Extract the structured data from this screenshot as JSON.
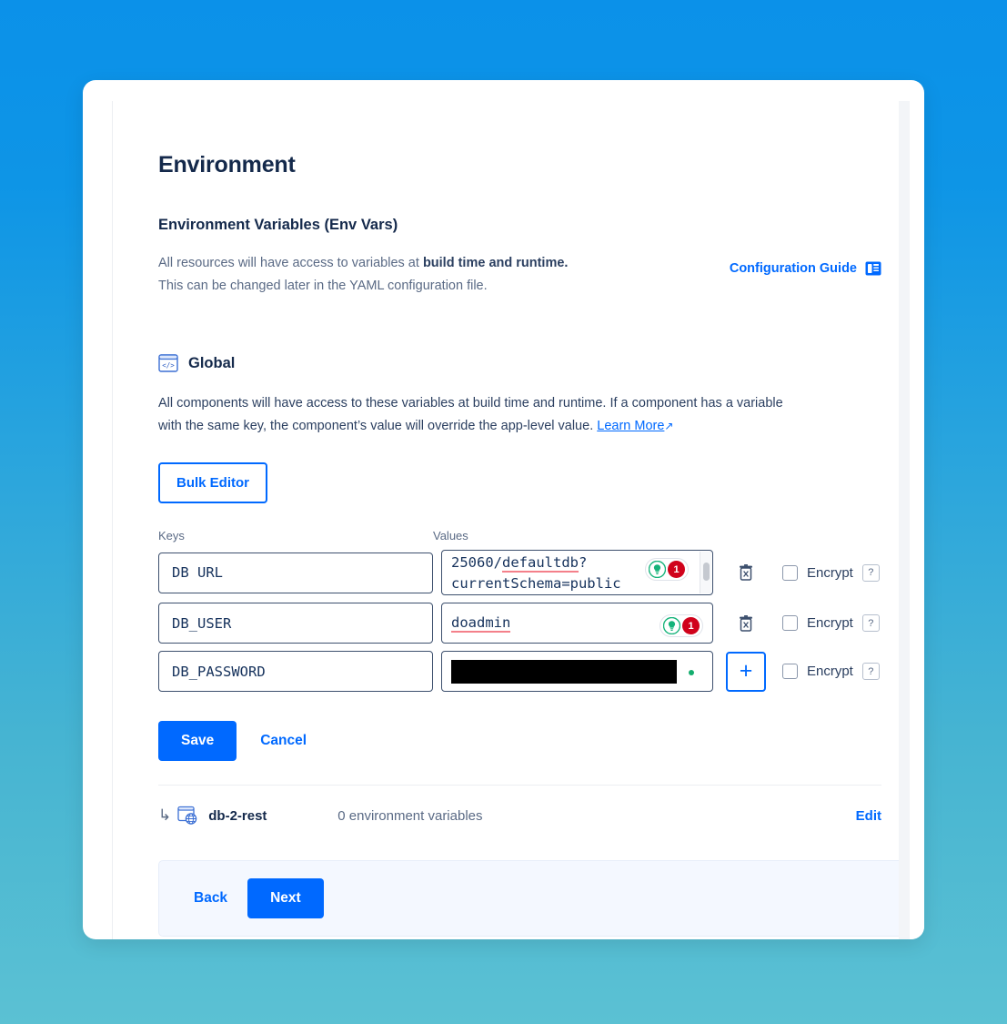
{
  "page": {
    "title": "Environment",
    "section_title": "Environment Variables (Env Vars)",
    "description_line1_prefix": "All resources will have access to variables at ",
    "description_line1_bold": "build time and runtime.",
    "description_line2": "This can be changed later in the YAML configuration file."
  },
  "config_guide": {
    "label": "Configuration Guide",
    "icon": "document-guide-icon"
  },
  "global": {
    "label": "Global",
    "icon": "code-window-icon",
    "description": "All components will have access to these variables at build time and runtime. If a component has a variable with the same key, the component’s value will override the app-level value. ",
    "learn_more": "Learn More",
    "external_arrow": "↗",
    "bulk_editor_label": "Bulk Editor"
  },
  "table": {
    "header_keys": "Keys",
    "header_values": "Values",
    "rows": [
      {
        "key": "DB URL",
        "value_line1": "25060/defaultdb?",
        "value_line2": "currentSchema=public",
        "spellcheck_word": "defaultdb",
        "assist_count": "1",
        "has_scrollbar": true,
        "action": "delete",
        "action_icon": "trash-icon",
        "encrypt_label": "Encrypt",
        "encrypt_checked": false,
        "help_label": "?"
      },
      {
        "key": "DB_USER",
        "value_line1": "doadmin",
        "value_line2": "",
        "spellcheck_word": "doadmin",
        "assist_count": "1",
        "has_scrollbar": false,
        "action": "delete",
        "action_icon": "trash-icon",
        "encrypt_label": "Encrypt",
        "encrypt_checked": false,
        "help_label": "?"
      },
      {
        "key": "DB_PASSWORD",
        "value_line1": "",
        "value_line2": "",
        "redacted": true,
        "assist_count": "",
        "has_scrollbar": false,
        "action": "add",
        "action_icon": "plus-icon",
        "action_label": "+",
        "encrypt_label": "Encrypt",
        "encrypt_checked": false,
        "help_label": "?"
      }
    ]
  },
  "form_actions": {
    "save_label": "Save",
    "cancel_label": "Cancel"
  },
  "component": {
    "arrow": "↳",
    "icon": "browser-globe-icon",
    "name": "db-2-rest",
    "count_text": "0 environment variables",
    "edit_label": "Edit"
  },
  "footer": {
    "back_label": "Back",
    "next_label": "Next"
  },
  "colors": {
    "accent_blue": "#0069ff",
    "title_navy": "#14294b",
    "badge_red": "#d0021b",
    "bulb_green": "#15b37a",
    "spellcheck_red": "#f4808a",
    "bg_top": "#0b91e9",
    "bg_bottom": "#5bc1d3",
    "footer_bg": "#f4f8ff"
  }
}
